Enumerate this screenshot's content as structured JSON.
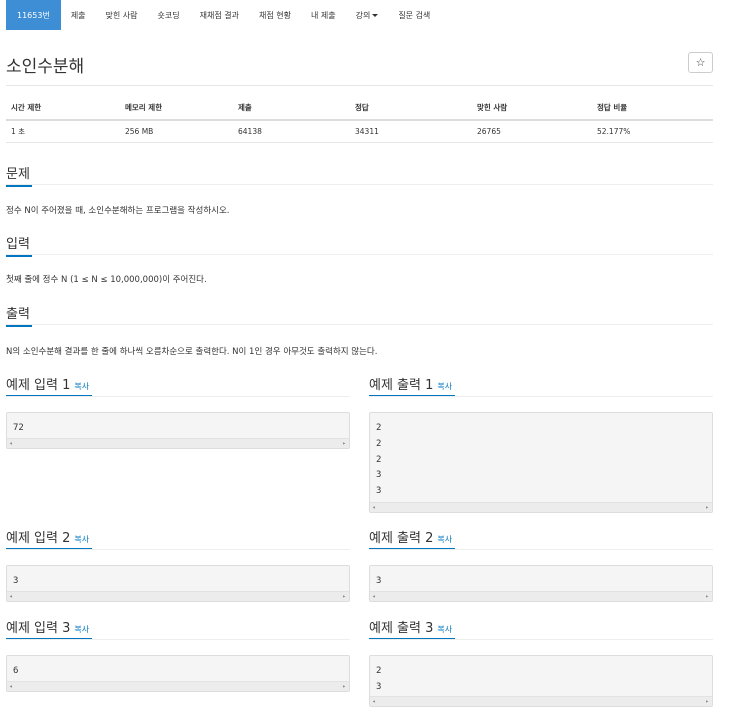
{
  "nav": {
    "items": [
      {
        "label": "11653번"
      },
      {
        "label": "제출"
      },
      {
        "label": "맞힌 사람"
      },
      {
        "label": "숏코딩"
      },
      {
        "label": "재채점 결과"
      },
      {
        "label": "채점 현황"
      },
      {
        "label": "내 제출"
      },
      {
        "label": "강의"
      },
      {
        "label": "질문 검색"
      }
    ]
  },
  "problem": {
    "title": "소인수분해",
    "star_icon": "☆"
  },
  "info": {
    "headers": [
      "시간 제한",
      "메모리 제한",
      "제출",
      "정답",
      "맞힌 사람",
      "정답 비율"
    ],
    "values": [
      "1 초",
      "256 MB",
      "64138",
      "34311",
      "26765",
      "52.177%"
    ]
  },
  "sections": {
    "problem_heading": "문제",
    "problem_text": "정수 N이 주어졌을 때, 소인수분해하는 프로그램을 작성하시오.",
    "input_heading": "입력",
    "input_text": "첫째 줄에 정수 N (1 ≤ N ≤ 10,000,000)이 주어진다.",
    "output_heading": "출력",
    "output_text": "N의 소인수분해 결과를 한 줄에 하나씩 오름차순으로 출력한다. N이 1인 경우 아무것도 출력하지 않는다."
  },
  "examples": {
    "copy_label": "복사",
    "input1_title": "예제 입력 1",
    "input1_lines": [
      "72"
    ],
    "output1_title": "예제 출력 1",
    "output1_lines": [
      "2",
      "2",
      "2",
      "3",
      "3"
    ],
    "input2_title": "예제 입력 2",
    "input2_lines": [
      "3"
    ],
    "output2_title": "예제 출력 2",
    "output2_lines": [
      "3"
    ],
    "input3_title": "예제 입력 3",
    "input3_lines": [
      "6"
    ],
    "output3_title": "예제 출력 3",
    "output3_lines": [
      "2",
      "3"
    ]
  },
  "scroll": {
    "left_arrow": "◂",
    "right_arrow": "▸"
  },
  "colors": {
    "nav_active": "#3d8ed4",
    "accent": "#0076c0"
  }
}
